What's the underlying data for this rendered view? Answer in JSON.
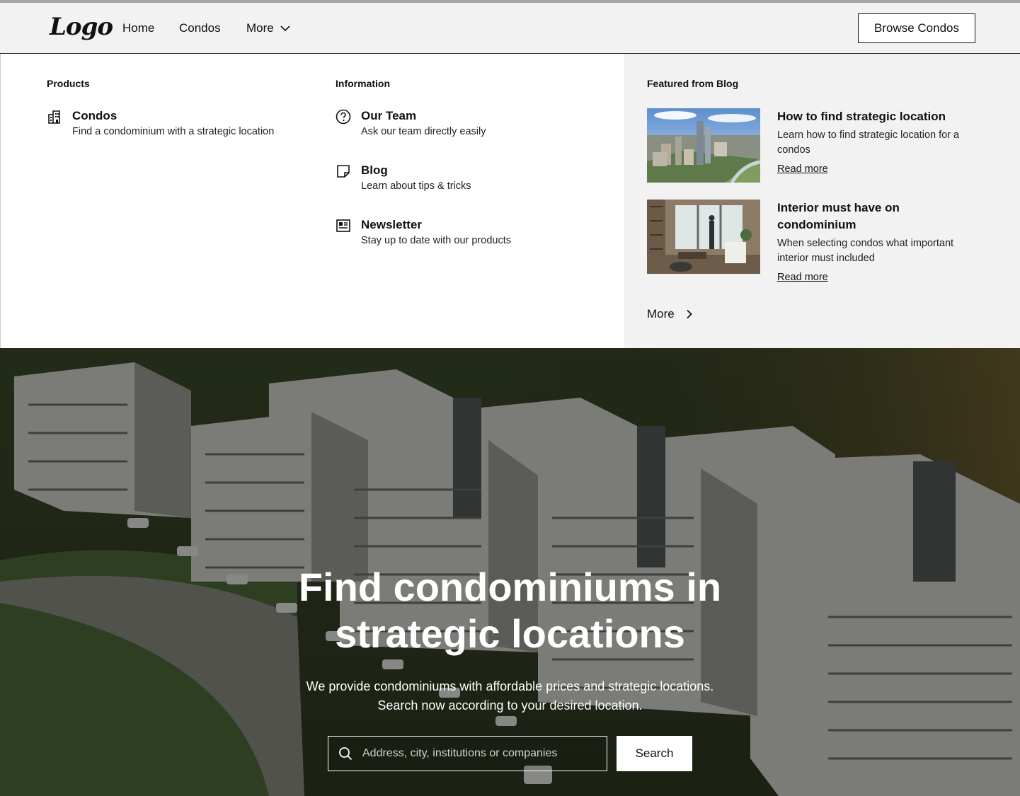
{
  "header": {
    "logo": "Logo",
    "nav": {
      "home": "Home",
      "condos": "Condos",
      "more": "More"
    },
    "cta": "Browse Condos"
  },
  "mega_menu": {
    "products": {
      "title": "Products",
      "items": [
        {
          "icon": "building-icon",
          "title": "Condos",
          "desc": "Find a condominium with a strategic location"
        }
      ]
    },
    "information": {
      "title": "Information",
      "items": [
        {
          "icon": "question-circle-icon",
          "title": "Our Team",
          "desc": "Ask our team directly easily"
        },
        {
          "icon": "sticky-note-icon",
          "title": "Blog",
          "desc": "Learn about tips & tricks"
        },
        {
          "icon": "newspaper-icon",
          "title": "Newsletter",
          "desc": "Stay up to date with our products"
        }
      ]
    },
    "featured": {
      "title": "Featured from Blog",
      "posts": [
        {
          "title": "How to find strategic location",
          "desc": "Learn how to find strategic location for a condos",
          "link": "Read more"
        },
        {
          "title": "Interior must have on condominium",
          "desc": "When selecting condos what important interior must included",
          "link": "Read more"
        }
      ],
      "more": "More"
    }
  },
  "hero": {
    "title_line1": "Find condominiums in",
    "title_line2": "strategic locations",
    "subtitle_line1": "We provide condominiums with affordable prices and strategic locations.",
    "subtitle_line2": "Search now according to your desired location.",
    "search_placeholder": "Address, city, institutions or companies",
    "search_button": "Search"
  }
}
